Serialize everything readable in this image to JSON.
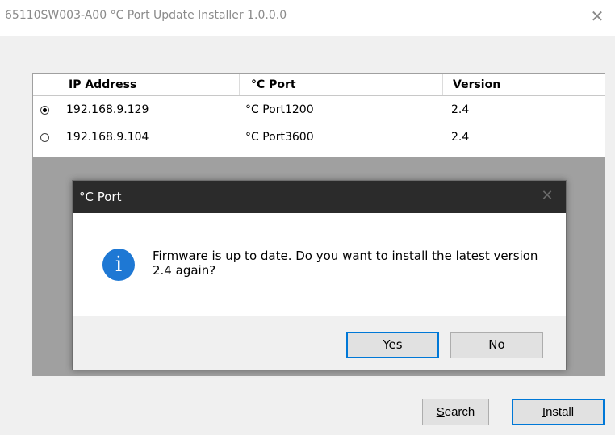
{
  "window": {
    "title": "65110SW003-A00 °C Port Update Installer 1.0.0.0",
    "close_glyph": "✕"
  },
  "device_list": {
    "columns": [
      "IP Address",
      "°C Port",
      "Version"
    ],
    "rows": [
      {
        "selected": true,
        "ip": "192.168.9.129",
        "port": "°C Port1200",
        "version": "2.4"
      },
      {
        "selected": false,
        "ip": "192.168.9.104",
        "port": "°C Port3600",
        "version": "2.4"
      }
    ]
  },
  "buttons": {
    "search": {
      "accel": "S",
      "rest": "earch"
    },
    "install": {
      "accel": "I",
      "rest": "nstall"
    }
  },
  "dialog": {
    "title": "°C Port",
    "close_glyph": "✕",
    "icon": "info-icon",
    "icon_glyph": "i",
    "message": "Firmware is up to date. Do you want to install the latest version 2.4 again?",
    "yes_label": "Yes",
    "no_label": "No"
  },
  "colors": {
    "accent": "#0078d7",
    "info_icon": "#1e78d4",
    "dialog_titlebar": "#2b2b2b",
    "overlay": "#a0a0a0"
  }
}
